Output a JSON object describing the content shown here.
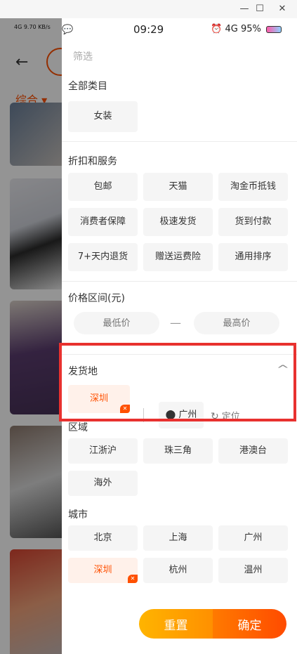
{
  "window": {
    "minimize": "—",
    "maximize": "☐",
    "close": "✕"
  },
  "background_page": {
    "status": "4G 9.70 KB/s",
    "back_icon": "back-arrow-icon",
    "sort_label": "综合 ▾"
  },
  "status_bar": {
    "time": "09:29",
    "network": "4G",
    "battery": "95%",
    "left_icons": "chat-icon"
  },
  "panel": {
    "title": "筛选",
    "category": {
      "title": "全部类目",
      "items": [
        "女装"
      ]
    },
    "discount": {
      "title": "折扣和服务",
      "items": [
        "包邮",
        "天猫",
        "淘金币抵钱",
        "消费者保障",
        "极速发货",
        "货到付款",
        "7+天内退货",
        "赠送运费险",
        "通用排序"
      ]
    },
    "price": {
      "title": "价格区间(元)",
      "min_placeholder": "最低价",
      "max_placeholder": "最高价",
      "separator": "—"
    },
    "ship_from": {
      "title": "发货地",
      "selected": "深圳",
      "current_location": "广州",
      "locate_label": "定位"
    },
    "region": {
      "title": "区域",
      "items": [
        "江浙沪",
        "珠三角",
        "港澳台",
        "海外"
      ]
    },
    "city": {
      "title": "城市",
      "items": [
        "北京",
        "上海",
        "广州",
        "深圳",
        "杭州",
        "温州"
      ],
      "selected": "深圳"
    },
    "buttons": {
      "reset": "重置",
      "confirm": "确定"
    }
  },
  "colors": {
    "accent": "#ff5000",
    "highlight_frame": "#e8312f"
  }
}
